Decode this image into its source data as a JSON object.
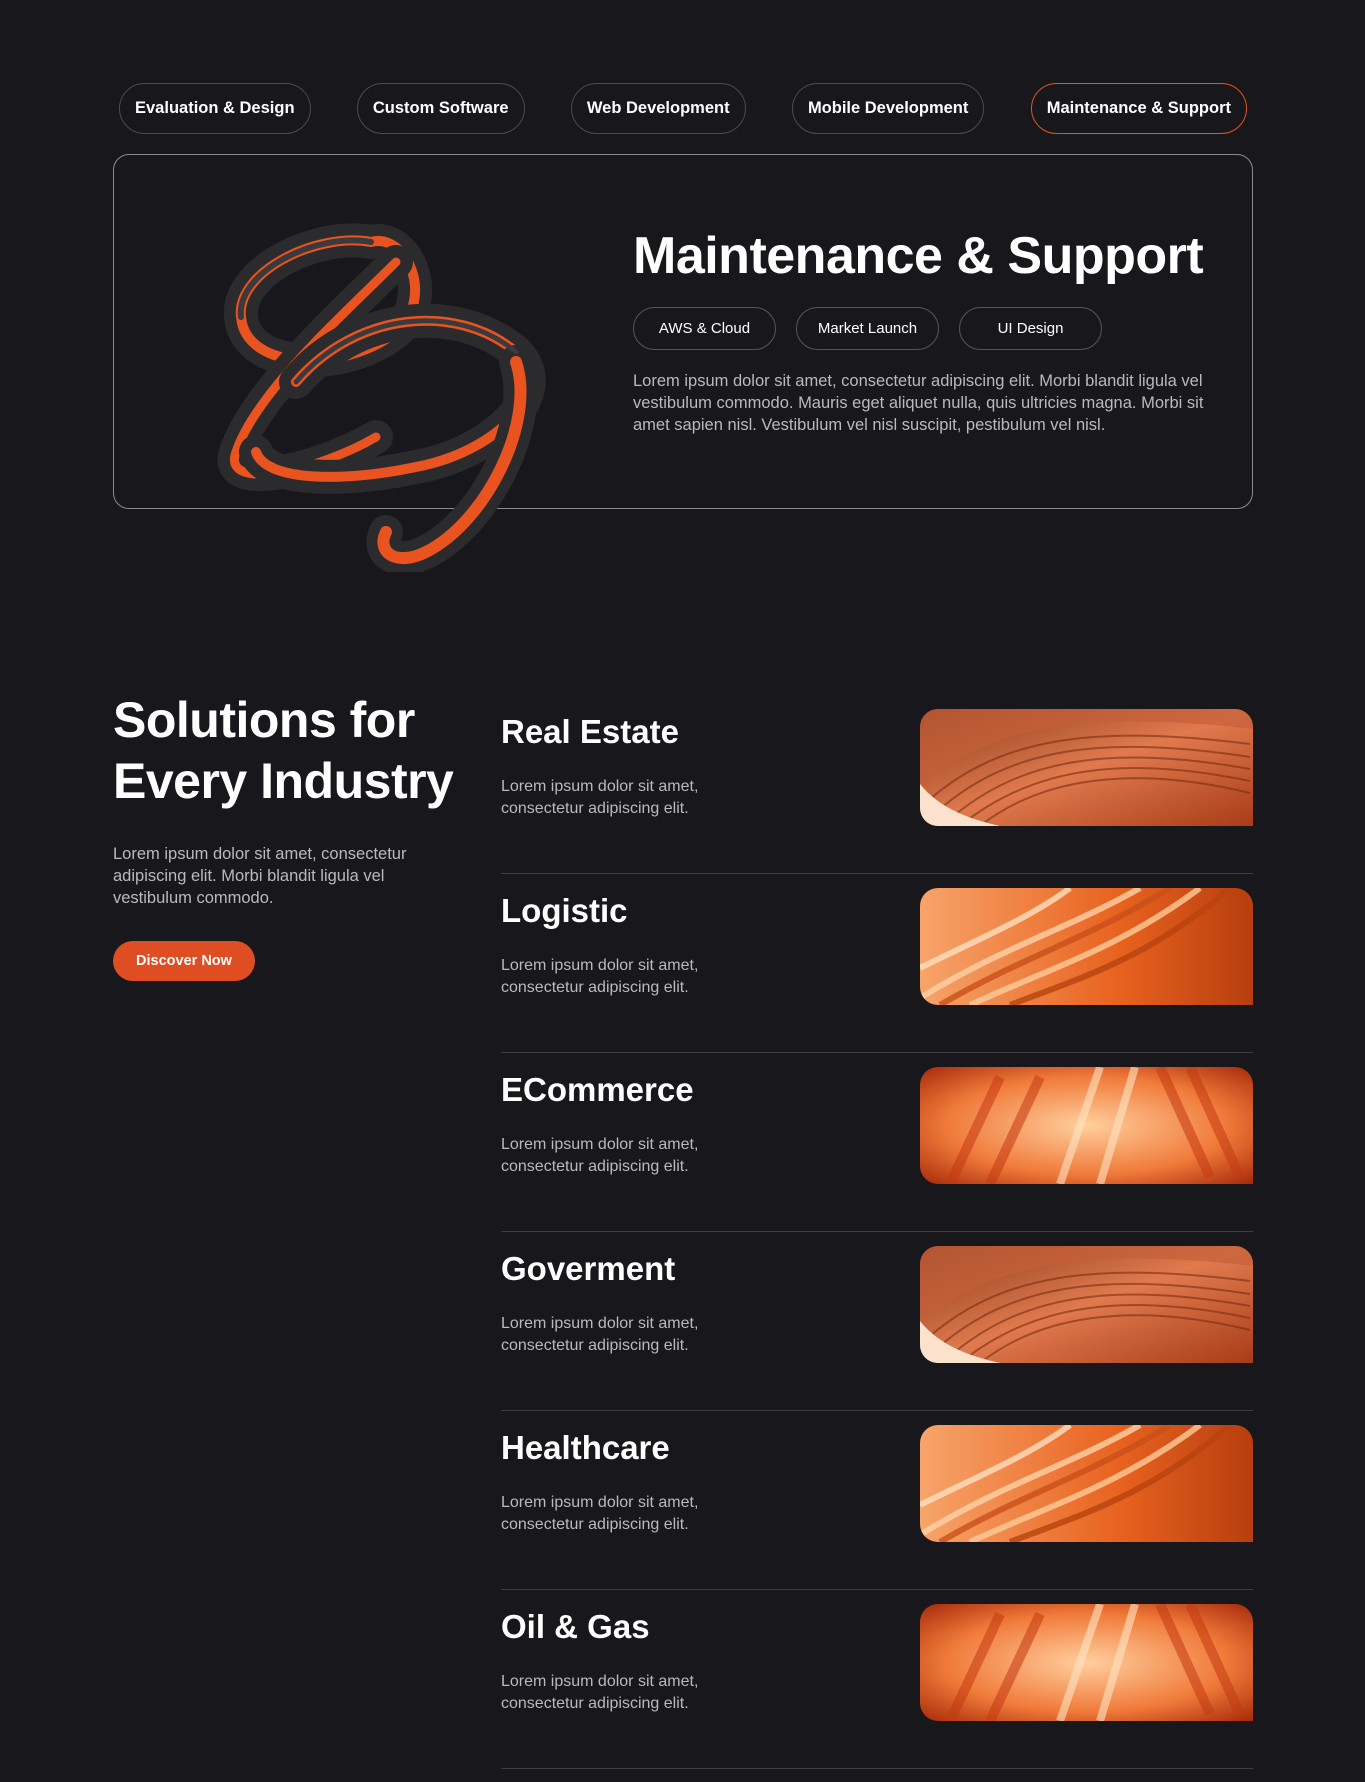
{
  "tabs": [
    {
      "label": "Evaluation & Design"
    },
    {
      "label": "Custom Software"
    },
    {
      "label": "Web Development"
    },
    {
      "label": "Mobile Development"
    },
    {
      "label": "Maintenance & Support"
    }
  ],
  "active_tab": "Maintenance & Support",
  "feature": {
    "title": "Maintenance & Support",
    "pills": [
      "AWS & Cloud",
      "Market Launch",
      "UI Design"
    ],
    "description": "Lorem ipsum dolor sit amet, consectetur adipiscing elit. Morbi blandit ligula vel vestibulum commodo. Mauris eget aliquet nulla, quis ultricies magna. Morbi sit amet sapien nisl. Vestibulum vel nisl suscipit, pestibulum vel nisl."
  },
  "solutions": {
    "title": "Solutions for Every Industry",
    "description": "Lorem ipsum dolor sit amet, consectetur adipiscing elit. Morbi blandit ligula vel vestibulum commodo.",
    "cta_label": "Discover Now"
  },
  "industries": [
    {
      "name": "Real Estate",
      "description": "Lorem ipsum dolor sit amet, consectetur adipiscing elit."
    },
    {
      "name": "Logistic",
      "description": "Lorem ipsum dolor sit amet, consectetur adipiscing elit."
    },
    {
      "name": "ECommerce",
      "description": "Lorem ipsum dolor sit amet, consectetur adipiscing elit."
    },
    {
      "name": "Goverment",
      "description": "Lorem ipsum dolor sit amet, consectetur adipiscing elit."
    },
    {
      "name": "Healthcare",
      "description": "Lorem ipsum dolor sit amet, consectetur adipiscing elit."
    },
    {
      "name": "Oil & Gas",
      "description": "Lorem ipsum dolor sit amet, consectetur adipiscing elit."
    }
  ],
  "colors": {
    "background": "#18181c",
    "accent": "#e8531f",
    "button": "#de4e22",
    "muted_text": "#b9b9be"
  }
}
